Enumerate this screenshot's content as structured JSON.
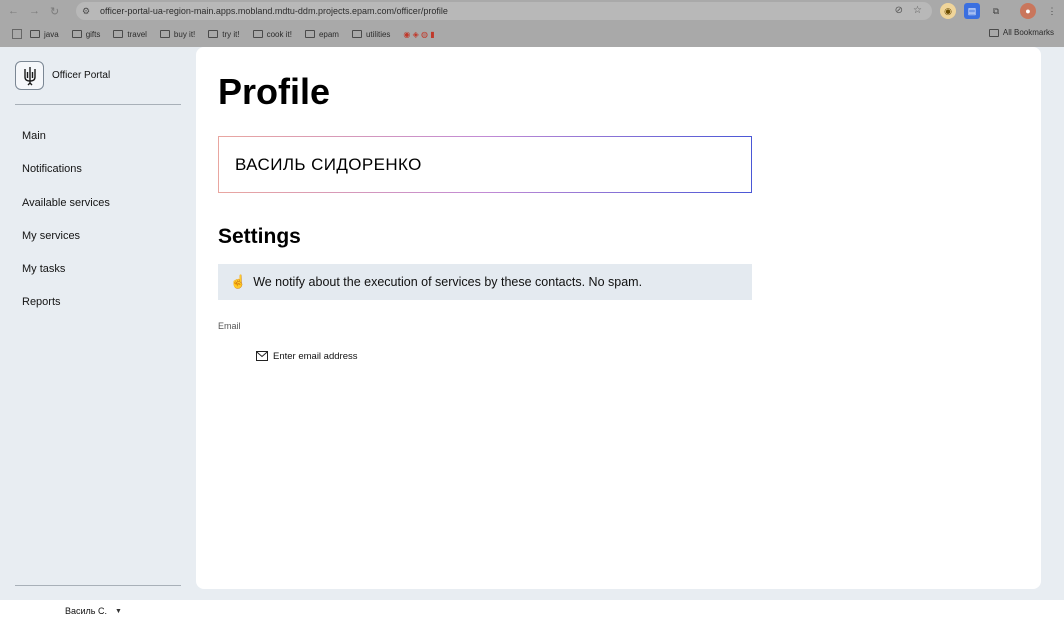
{
  "browser": {
    "url": "officer-portal-ua-region-main.apps.mobland.mdtu-ddm.projects.epam.com/officer/profile",
    "bookmarks": [
      "java",
      "gifts",
      "travel",
      "buy it!",
      "try it!",
      "cook it!",
      "epam",
      "utilities"
    ],
    "all_bookmarks": "All Bookmarks"
  },
  "brand": {
    "name": "Officer Portal",
    "logo_icon": "trident-icon"
  },
  "nav": {
    "items": [
      {
        "label": "Main"
      },
      {
        "label": "Notifications"
      },
      {
        "label": "Available services"
      },
      {
        "label": "My services"
      },
      {
        "label": "My tasks"
      },
      {
        "label": "Reports"
      }
    ]
  },
  "user": {
    "name": "Василь С."
  },
  "profile": {
    "title": "Profile",
    "full_name": "ВАСИЛЬ СИДОРЕНКО",
    "settings_title": "Settings",
    "notice": "We notify about the execution of services by these contacts. No spam.",
    "email_label": "Email",
    "email_placeholder": "Enter email address",
    "email_value": ""
  },
  "colors": {
    "accent": "#4a57d6",
    "sidebar_bg": "#e8edf2",
    "notice_bg": "#e4eaf0"
  }
}
